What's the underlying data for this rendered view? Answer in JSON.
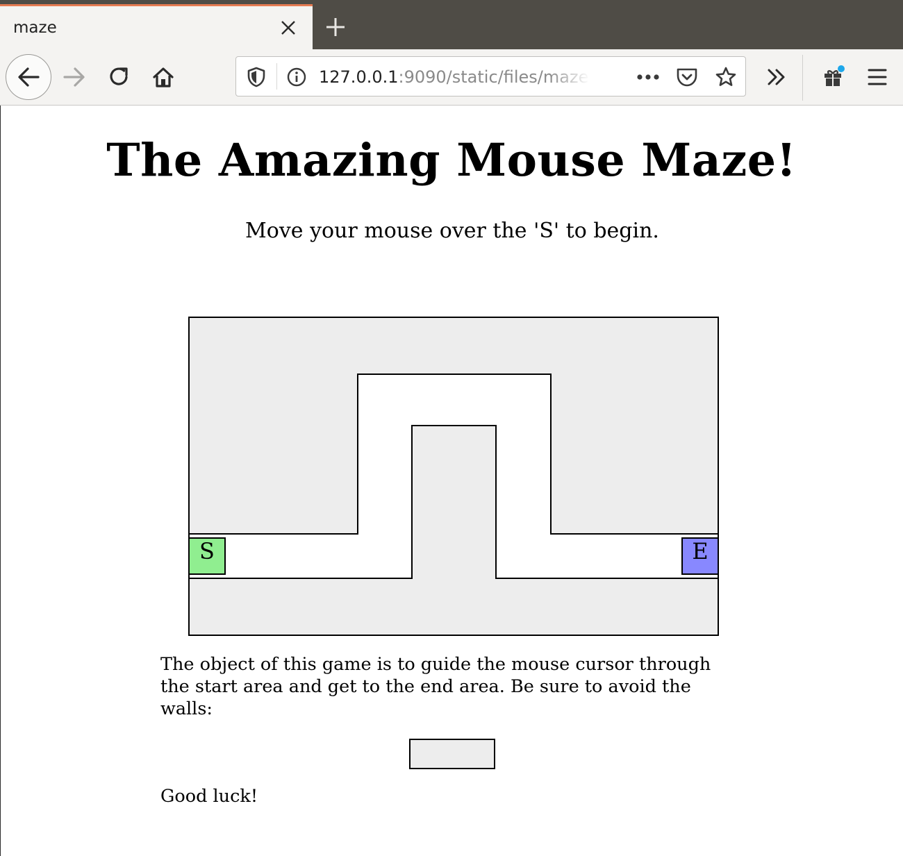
{
  "browser": {
    "tab_title": "maze",
    "url_host": "127.0.0.1",
    "url_rest": ":9090/static/files/maze"
  },
  "page": {
    "title": "The Amazing Mouse Maze!",
    "instructions": "Move your mouse over the 'S' to begin.",
    "start_label": "S",
    "end_label": "E",
    "description": "The object of this game is to guide the mouse cursor through the start area and get to the end area. Be sure to avoid the walls:",
    "closing": "Good luck!"
  },
  "colors": {
    "wall": "#ededed",
    "path": "#ffffff",
    "start": "#90ee90",
    "end": "#8888ff"
  },
  "icons": {
    "back": "arrow-left-icon",
    "forward": "arrow-right-icon",
    "reload": "reload-icon",
    "home": "home-icon",
    "tracking": "shield-icon",
    "info": "info-icon",
    "page_actions": "ellipsis-icon",
    "pocket": "pocket-icon",
    "bookmark": "star-icon",
    "overflow": "double-chevron-icon",
    "whats_new": "gift-icon",
    "menu": "hamburger-menu-icon"
  }
}
